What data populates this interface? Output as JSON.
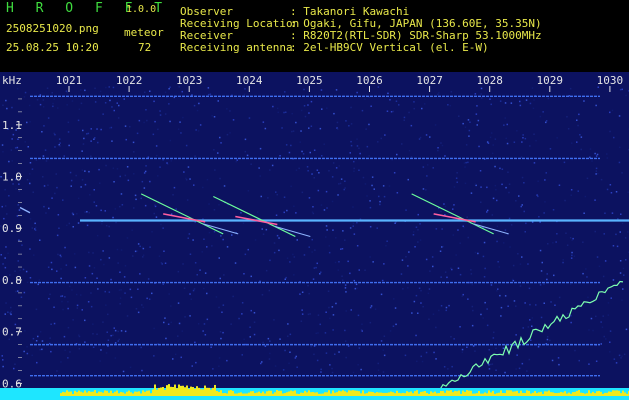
{
  "app": {
    "logo": "H R O F F T",
    "version": "1.0.0",
    "filename": "2508251020.png",
    "timestamp": "25.08.25 10:20",
    "mode_label": "meteor",
    "count": "72"
  },
  "info": {
    "rows": [
      {
        "key": "Observer",
        "value": ": Takanori Kawachi"
      },
      {
        "key": "Receiving Location",
        "value": ": Ogaki, Gifu, JAPAN (136.60E, 35.35N)"
      },
      {
        "key": "Receiver",
        "value": ": R820T2(RTL-SDR) SDR-Sharp 53.1000MHz"
      },
      {
        "key": "Receiving antenna",
        "value": ": 2el-HB9CV Vertical (el. E-W)"
      }
    ]
  },
  "colors": {
    "background": "#000000",
    "plot_bg": "#0c1260",
    "header_green": "#3fdc3f",
    "header_yellow": "#e8e84a",
    "axis_text": "#e6e6e6",
    "baseline_cyan": "#1ee6ff",
    "baseline_yellow": "#f0ea1e"
  },
  "chart_data": {
    "type": "heatmap",
    "ylabel": "kHz",
    "x_ticks": [
      "1021",
      "1022",
      "1023",
      "1024",
      "1025",
      "1026",
      "1027",
      "1028",
      "1029",
      "1030"
    ],
    "y_ticks": [
      "1.1",
      "1.0",
      "0.9",
      "0.8",
      "0.7",
      "0.6"
    ],
    "ylim": [
      0.58,
      1.2
    ],
    "xlim": [
      1020.3,
      1030.3
    ],
    "carriers_khz": [
      1.155,
      1.035,
      0.915,
      0.795,
      0.675,
      0.615
    ],
    "meteor_echoes": [
      {
        "time": 1022.9,
        "freq_khz": 0.92
      },
      {
        "time": 1024.1,
        "freq_khz": 0.915
      },
      {
        "time": 1027.4,
        "freq_khz": 0.92
      }
    ]
  }
}
